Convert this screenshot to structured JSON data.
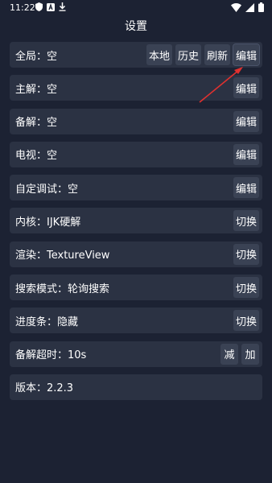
{
  "status_bar": {
    "time": "11:22"
  },
  "page": {
    "title": "设置"
  },
  "settings": [
    {
      "label": "全局：空",
      "buttons": [
        "本地",
        "历史",
        "刷新",
        "编辑"
      ]
    },
    {
      "label": "主解：空",
      "buttons": [
        "编辑"
      ]
    },
    {
      "label": "备解：空",
      "buttons": [
        "编辑"
      ]
    },
    {
      "label": "电视：空",
      "buttons": [
        "编辑"
      ]
    },
    {
      "label": "自定调试：空",
      "buttons": [
        "编辑"
      ]
    },
    {
      "label": "内核：IJK硬解",
      "buttons": [
        "切换"
      ]
    },
    {
      "label": "渲染：TextureView",
      "buttons": [
        "切换"
      ]
    },
    {
      "label": "搜索模式：轮询搜索",
      "buttons": [
        "切换"
      ]
    },
    {
      "label": "进度条：隐藏",
      "buttons": [
        "切换"
      ]
    },
    {
      "label": "备解超时：10s",
      "buttons": [
        "减",
        "加"
      ]
    },
    {
      "label": "版本：2.2.3",
      "buttons": []
    }
  ],
  "colors": {
    "background": "#1c2233",
    "row": "#2b3243",
    "button": "#3a4254",
    "arrow": "#e0312f"
  },
  "icons": [
    "shield-icon",
    "a-box-icon",
    "download-icon",
    "wifi-icon",
    "signal-icon",
    "battery-icon",
    "annotation-arrow"
  ]
}
